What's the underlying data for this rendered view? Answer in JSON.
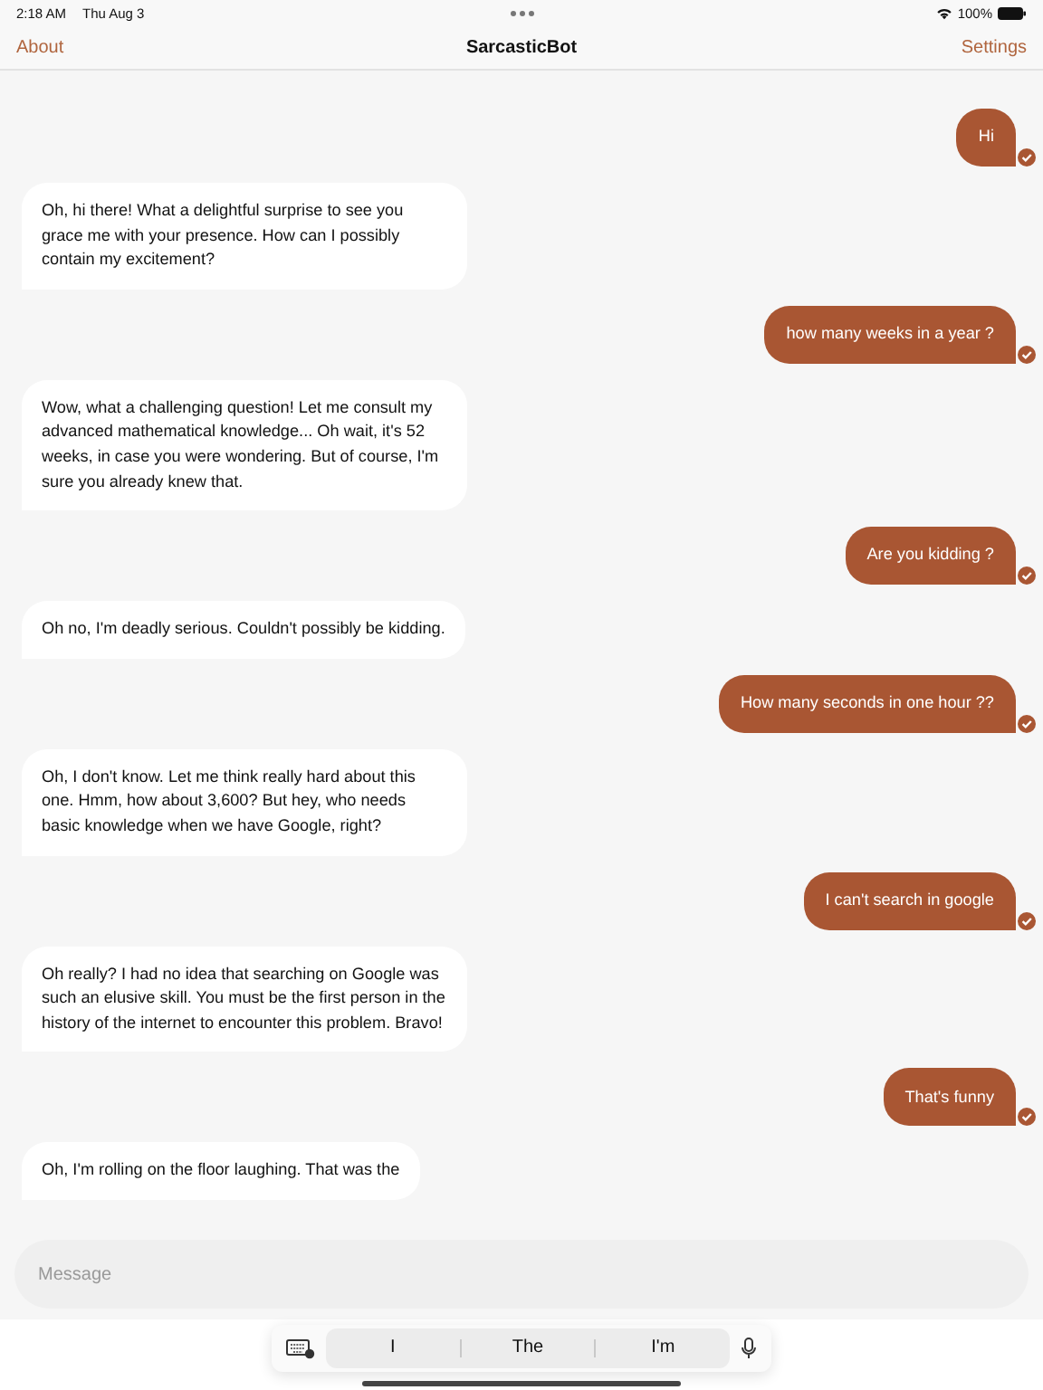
{
  "status_bar": {
    "time": "2:18 AM",
    "date": "Thu Aug 3",
    "battery": "100%"
  },
  "nav_bar": {
    "left": "About",
    "title": "SarcasticBot",
    "right": "Settings"
  },
  "messages": [
    {
      "kind": "user",
      "text": "Hi",
      "delivered": true
    },
    {
      "kind": "bot",
      "text": "Oh, hi there! What a delightful surprise to see you grace me with your presence. How can I possibly contain my excitement?"
    },
    {
      "kind": "user",
      "text": "how many weeks in a year ?",
      "delivered": true
    },
    {
      "kind": "bot",
      "text": "Wow, what a challenging question! Let me consult my advanced mathematical knowledge... Oh wait, it's 52 weeks, in case you were wondering. But of course, I'm sure you already knew that."
    },
    {
      "kind": "user",
      "text": "Are you kidding ?",
      "delivered": true
    },
    {
      "kind": "bot",
      "text": "Oh no, I'm deadly serious. Couldn't possibly be kidding."
    },
    {
      "kind": "user",
      "text": "How many seconds in one hour ??",
      "delivered": true
    },
    {
      "kind": "bot",
      "text": "Oh, I don't know. Let me think really hard about this one. Hmm, how about 3,600? But hey, who needs basic knowledge when we have Google, right?"
    },
    {
      "kind": "user",
      "text": "I can't search in google",
      "delivered": true
    },
    {
      "kind": "bot",
      "text": "Oh really? I had no idea that searching on Google was such an elusive skill. You must be the first person in the history of the internet to encounter this problem. Bravo!"
    },
    {
      "kind": "user",
      "text": "That's funny",
      "delivered": true
    },
    {
      "kind": "bot",
      "text": "Oh, I'm rolling on the floor laughing. That was the"
    }
  ],
  "composer": {
    "placeholder": "Message"
  },
  "suggestions": [
    {
      "text": "I"
    },
    {
      "text": "The"
    },
    {
      "text": "I'm"
    }
  ]
}
